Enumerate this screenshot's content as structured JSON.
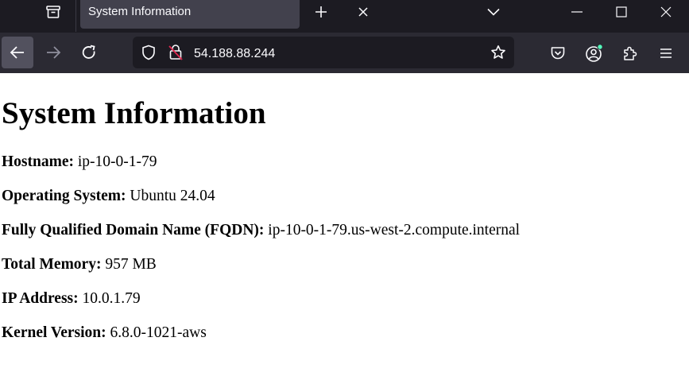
{
  "browser": {
    "tab_title": "System Information",
    "url": "54.188.88.244",
    "colors": {
      "tabbar_bg": "#1c1b22",
      "toolbar_bg": "#2b2a33",
      "active_tab_bg": "#42414d",
      "account_dot": "#54ffbd"
    }
  },
  "page": {
    "heading": "System Information",
    "rows": [
      {
        "label": "Hostname:",
        "value": "ip-10-0-1-79"
      },
      {
        "label": "Operating System:",
        "value": "Ubuntu 24.04"
      },
      {
        "label": "Fully Qualified Domain Name (FQDN):",
        "value": "ip-10-0-1-79.us-west-2.compute.internal"
      },
      {
        "label": "Total Memory:",
        "value": "957 MB"
      },
      {
        "label": "IP Address:",
        "value": "10.0.1.79"
      },
      {
        "label": "Kernel Version:",
        "value": "6.8.0-1021-aws"
      }
    ]
  }
}
